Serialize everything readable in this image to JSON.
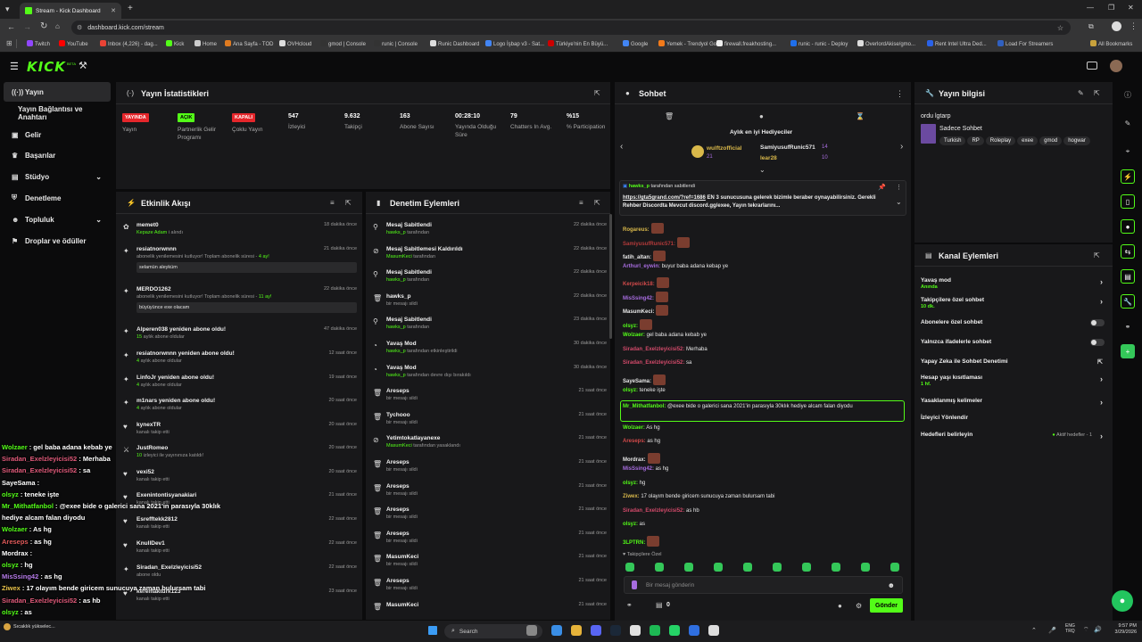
{
  "browser": {
    "tab_title": "Stream - Kick Dashboard",
    "url": "dashboard.kick.com/stream",
    "bookmarks": [
      "Twitch",
      "YouTube",
      "Inbox (4,226) - dag...",
      "Kick",
      "Home",
      "Ana Sayfa - TOD",
      "OVHcloud",
      "gmod | Console",
      "runic | Console",
      "Runic Dashboard",
      "Logo İşbap v3 - Sat...",
      "Türkiye'nin En Büyü...",
      "Google",
      "Yemek - Trendyol Go",
      "firewall.freakhosting...",
      "runic - runic - Deploy",
      "OverlordAkise/gmo...",
      "Rent Intel Ultra Ded...",
      "Load For Streamers"
    ],
    "all_bookmarks": "All Bookmarks"
  },
  "app": {
    "logo": "KICK",
    "logo_beta": "BETA"
  },
  "sidebar": {
    "items": [
      {
        "label": "Yayın",
        "icon": "broadcast-icon"
      },
      {
        "label": "Yayın Bağlantısı ve Anahtarı",
        "icon": ""
      },
      {
        "label": "Gelir",
        "icon": "money-icon"
      },
      {
        "label": "Başarılar",
        "icon": "trophy-icon"
      },
      {
        "label": "Stüdyo",
        "icon": "studio-icon"
      },
      {
        "label": "Denetleme",
        "icon": "shield-icon"
      },
      {
        "label": "Topluluk",
        "icon": "community-icon"
      },
      {
        "label": "Droplar ve ödüller",
        "icon": "gift-icon"
      }
    ]
  },
  "stats": {
    "title": "Yayın İstatistikleri",
    "items": [
      {
        "value": "YAYINDA",
        "label": "Yayın",
        "badge": "red"
      },
      {
        "value": "AÇIK",
        "label": "Partnerlik Gelir Programı",
        "badge": "green"
      },
      {
        "value": "KAPALI",
        "label": "Çoklu Yayın",
        "badge": "red"
      },
      {
        "value": "547",
        "label": "İzleyici"
      },
      {
        "value": "9.632",
        "label": "Takipçi"
      },
      {
        "value": "163",
        "label": "Abone Sayısı"
      },
      {
        "value": "00:28:10",
        "label": "Yayında Olduğu Süre"
      },
      {
        "value": "79",
        "label": "Chatters In Avg."
      },
      {
        "value": "%15",
        "label": "% Participation"
      }
    ]
  },
  "activity": {
    "title": "Etkinlik Akışı",
    "items": [
      {
        "title": "memet0",
        "sub_green": "Kepaze Adam",
        "sub": " i alındı",
        "time": "18 dakika önce"
      },
      {
        "title": "resiatnorwnnn",
        "sub": "abonelik yenilemesini kutluyor! Toplam abonelik süresi - ",
        "sub_green": "4 ay!",
        "time": "21 dakika önce",
        "message": "selamün aleyküm"
      },
      {
        "title": "MERDO1262",
        "sub": "abonelik yenilemesini kutluyor! Toplam abonelik süresi - ",
        "sub_green": "11 ay!",
        "time": "22 dakika önce",
        "message": "büyüyünce exe olacam"
      },
      {
        "title": "Alperen038 yeniden abone oldu!",
        "sub_green": "15",
        "sub": " aylık abone oldular",
        "time": "47 dakika önce"
      },
      {
        "title": "resiatnorwnnn yeniden abone oldu!",
        "sub_green": "4",
        "sub": " aylık abone oldular",
        "time": "12 saat önce"
      },
      {
        "title": "LinfoJr yeniden abone oldu!",
        "sub_green": "4",
        "sub": " aylık abone oldular",
        "time": "19 saat önce"
      },
      {
        "title": "m1nars yeniden abone oldu!",
        "sub_green": "4",
        "sub": " aylık abone oldular",
        "time": "20 saat önce"
      },
      {
        "title": "kynexTR",
        "sub": "kanalı takip etti",
        "time": "20 saat önce"
      },
      {
        "title": "JustRomeo",
        "sub_green": "10",
        "sub": " izleyici ile yayınınıza katıldı!",
        "time": "20 saat önce"
      },
      {
        "title": "vexi52",
        "sub": "kanalı takip etti",
        "time": "20 saat önce"
      },
      {
        "title": "Exenintontisyanakiari",
        "sub": "kanalı takip etti",
        "time": "21 saat önce"
      },
      {
        "title": "Esrefftekk2812",
        "sub": "kanalı takip etti",
        "time": "22 saat önce"
      },
      {
        "title": "KnullDev1",
        "sub": "kanalı takip etti",
        "time": "22 saat önce"
      },
      {
        "title": "Siradan_Exelzleyicisi52",
        "sub": "abone oldu",
        "time": "22 saat önce"
      },
      {
        "title": "keremakturk123",
        "sub": "kanalı takip etti",
        "time": "23 saat önce"
      }
    ]
  },
  "moderation": {
    "title": "Denetim Eylemleri",
    "items": [
      {
        "title": "Mesaj Sabitlendi",
        "green": "hawks_p",
        "sub": " tarafından",
        "time": "22 dakika önce",
        "icon": "pin-icon"
      },
      {
        "title": "Mesaj Sabitlemesi Kaldırıldı",
        "green": "MasumKeci",
        "sub": " tarafından",
        "time": "22 dakika önce",
        "icon": "unpin-icon"
      },
      {
        "title": "Mesaj Sabitlendi",
        "green": "hawks_p",
        "sub": " tarafından",
        "time": "22 dakika önce",
        "icon": "pin-icon"
      },
      {
        "title": "hawks_p",
        "green": "",
        "sub": "bir mesajı sildi",
        "time": "22 dakika önce",
        "icon": "trash-icon"
      },
      {
        "title": "Mesaj Sabitlendi",
        "green": "hawks_p",
        "sub": " tarafından",
        "time": "23 dakika önce",
        "icon": "pin-icon"
      },
      {
        "title": "Yavaş Mod",
        "green": "hawks_p",
        "sub": " tarafından etkinleştirildi",
        "time": "30 dakika önce",
        "icon": "slow-mode-icon"
      },
      {
        "title": "Yavaş Mod",
        "green": "hawks_p",
        "sub": " tarafından devre dışı bırakıldı",
        "time": "30 dakika önce",
        "icon": "slow-mode-icon"
      },
      {
        "title": "Areseps",
        "green": "",
        "sub": "bir mesajı sildi",
        "time": "21 saat önce",
        "icon": "trash-icon"
      },
      {
        "title": "Tychooo",
        "green": "",
        "sub": "bir mesajı sildi",
        "time": "21 saat önce",
        "icon": "trash-icon"
      },
      {
        "title": "Yetimtokatlayanexe",
        "green": "MasumKeci",
        "sub": " tarafından yasaklandı",
        "time": "21 saat önce",
        "icon": "ban-icon"
      },
      {
        "title": "Areseps",
        "green": "",
        "sub": "bir mesajı sildi",
        "time": "21 saat önce",
        "icon": "trash-icon"
      },
      {
        "title": "Areseps",
        "green": "",
        "sub": "bir mesajı sildi",
        "time": "21 saat önce",
        "icon": "trash-icon"
      },
      {
        "title": "Areseps",
        "green": "",
        "sub": "bir mesajı sildi",
        "time": "21 saat önce",
        "icon": "trash-icon"
      },
      {
        "title": "Areseps",
        "green": "",
        "sub": "bir mesajı sildi",
        "time": "21 saat önce",
        "icon": "trash-icon"
      },
      {
        "title": "MasumKeci",
        "green": "",
        "sub": "bir mesajı sildi",
        "time": "21 saat önce",
        "icon": "trash-icon"
      },
      {
        "title": "Areseps",
        "green": "",
        "sub": "bir mesajı sildi",
        "time": "21 saat önce",
        "icon": "trash-icon"
      },
      {
        "title": "MasumKeci",
        "green": "",
        "sub": "",
        "time": "21 saat önce",
        "icon": "trash-icon"
      }
    ]
  },
  "chat": {
    "title": "Sohbet",
    "gifters_title": "Aylık en iyi Hediyeciler",
    "gifters": [
      {
        "name": "wulftzofficial",
        "count": "21"
      },
      {
        "name": "SamiyusufRunic571",
        "count": "14"
      },
      {
        "name": "lear28",
        "count": "10"
      }
    ],
    "pinned_by": "hawks_p",
    "pinned_by_suffix": "tarafından sabitlendi",
    "pinned_link": "https://gta5grand.com/?ref=1686",
    "pinned_text": " EN 3 sunucusuna gelerek bizimle beraber oynayabilirsiniz. Gerekli Rehber Discordta Mevcut discord.gg/exee, Yayın tekrarlarını...",
    "messages": [
      {
        "user": "Rogareus:",
        "color": "#d9b84a",
        "text": "",
        "emote": true
      },
      {
        "user": "SamiyusufRunic571:",
        "color": "#b33a3a",
        "text": "",
        "emote": true
      },
      {
        "user": "fatih_altan:",
        "color": "#e8e8e8",
        "text": "",
        "emote": true
      },
      {
        "user": "Arthurl_eywin:",
        "color": "#a86de0",
        "text": " buyur baba adana kebap ye",
        "emote": false
      },
      {
        "user": "Kerpeicik18:",
        "color": "#d24a4a",
        "text": "",
        "emote": true
      },
      {
        "user": "MisSsing42:",
        "color": "#a86de0",
        "text": "",
        "emote": true
      },
      {
        "user": "MasumKeci:",
        "color": "#e8e8e8",
        "text": "",
        "emote": true
      },
      {
        "user": "olsyz:",
        "color": "#53fc18",
        "text": "",
        "emote": true
      },
      {
        "user": "Wolzaer:",
        "color": "#53fc18",
        "text": " gel baba adana kebab ye",
        "emote": false
      },
      {
        "user": "Siradan_Exelzleyicisi52:",
        "color": "#d24a6a",
        "text": " Merhaba",
        "emote": false
      },
      {
        "user": "Siradan_Exelzleyicisi52:",
        "color": "#d24a6a",
        "text": " sa",
        "emote": false
      },
      {
        "user": "SayeSama:",
        "color": "#e8e8e8",
        "text": "",
        "emote": true
      },
      {
        "user": "olsyz:",
        "color": "#53fc18",
        "text": " teneke işte",
        "emote": false
      },
      {
        "user": "Mr_Mithatfanbol:",
        "color": "#53fc18",
        "text": " @exee bide o galerici sana 2021'in parasıyla 30klık hediye alcam falan diyodu",
        "emote": false,
        "highlight": true
      },
      {
        "user": "Wolzaer:",
        "color": "#53fc18",
        "text": " As hg",
        "emote": false
      },
      {
        "user": "Areseps:",
        "color": "#d24a4a",
        "text": " as hg",
        "emote": false
      },
      {
        "user": "Mordrax:",
        "color": "#e8e8e8",
        "text": "",
        "emote": true
      },
      {
        "user": "MisSsing42:",
        "color": "#a86de0",
        "text": " as hg",
        "emote": false
      },
      {
        "user": "olsyz:",
        "color": "#53fc18",
        "text": " hg",
        "emote": false
      },
      {
        "user": "Ziwex:",
        "color": "#d9b84a",
        "text": " 17 olayım bende giricem sunucuya zaman bulursam tabi",
        "emote": false
      },
      {
        "user": "Siradan_Exelzleyicisi52:",
        "color": "#d24a6a",
        "text": " as hb",
        "emote": false
      },
      {
        "user": "olsyz:",
        "color": "#53fc18",
        "text": " as",
        "emote": false
      },
      {
        "user": "3LPTRN:",
        "color": "#53fc18",
        "text": "",
        "emote": true
      }
    ],
    "followers_only": "Takipçilere Özel",
    "input_placeholder": "Bir mesaj gönderin",
    "points": "0",
    "send_label": "Gönder"
  },
  "stream_info": {
    "title": "Yayın bilgisi",
    "stream_title": "ordu lgtarp",
    "category": "Sadece Sohbet",
    "tags": [
      "Turkish",
      "RP",
      "Roleplay",
      "exee",
      "gmod",
      "hogwar"
    ]
  },
  "channel_actions": {
    "title": "Kanal Eylemleri",
    "items": [
      {
        "label": "Yavaş mod",
        "sub": "Anında",
        "control": "chevron"
      },
      {
        "label": "Takipçilere özel sohbet",
        "sub": "10 dk.",
        "control": "chevron"
      },
      {
        "label": "Abonelere özel sohbet",
        "sub": "",
        "control": "toggle"
      },
      {
        "label": "Yalnızca ifadelerle sohbet",
        "sub": "",
        "control": "toggle"
      },
      {
        "label": "Yapay Zeka ile Sohbet Denetimi",
        "sub": "",
        "control": "external"
      },
      {
        "label": "Hesap yaşı kısıtlaması",
        "sub": "1 hf.",
        "control": "chevron"
      },
      {
        "label": "Yasaklanmış kelimeler",
        "sub": "",
        "control": "chevron"
      },
      {
        "label": "İzleyici Yönlendir",
        "sub": "",
        "control": ""
      },
      {
        "label": "Hedefleri belirleyin",
        "sub": "",
        "control": "chevron",
        "right": "Aktif hedefler - 1"
      }
    ]
  },
  "overlay_chat": [
    {
      "user": "Wolzaer",
      "color": "#53fc18",
      "text": " : gel baba adana kebab ye"
    },
    {
      "user": "Siradan_Exelzleyicisi52",
      "color": "#e05a7a",
      "text": " : Merhaba"
    },
    {
      "user": "Siradan_Exelzleyicisi52",
      "color": "#e05a7a",
      "text": " : sa"
    },
    {
      "user": "SayeSama",
      "color": "#ffffff",
      "text": " :"
    },
    {
      "user": "olsyz",
      "color": "#53fc18",
      "text": " : teneke işte"
    },
    {
      "user": "Mr_Mithatfanbol",
      "color": "#53fc18",
      "text": " : @exee bide o galerici sana 2021'in parasıyla 30klık"
    },
    {
      "user": "",
      "color": "#ffffff",
      "text": "hediye alcam falan diyodu"
    },
    {
      "user": "Wolzaer",
      "color": "#53fc18",
      "text": " : As hg"
    },
    {
      "user": "Areseps",
      "color": "#e05a5a",
      "text": " : as hg"
    },
    {
      "user": "Mordrax",
      "color": "#ffffff",
      "text": " :"
    },
    {
      "user": "olsyz",
      "color": "#53fc18",
      "text": " : hg"
    },
    {
      "user": "MisSsing42",
      "color": "#b57ae8",
      "text": " : as hg"
    },
    {
      "user": "Ziwex",
      "color": "#e8c24a",
      "text": " : 17 olayım bende giricem sunucuya zaman bulursam tabi"
    },
    {
      "user": "Siradan_Exelzleyicisi52",
      "color": "#e05a7a",
      "text": " : as hb"
    },
    {
      "user": "olsyz",
      "color": "#53fc18",
      "text": " : as"
    }
  ],
  "taskbar": {
    "weather": "Sıcaklık yükselec...",
    "search": "Search",
    "lang": "ENG",
    "lang2": "TRQ",
    "time": "9:57 PM",
    "date": "3/29/2026"
  },
  "colors": {
    "accent": "#53fc18",
    "live_red": "#e5262b",
    "panel": "#18181a",
    "bg": "#0b0b0c"
  }
}
